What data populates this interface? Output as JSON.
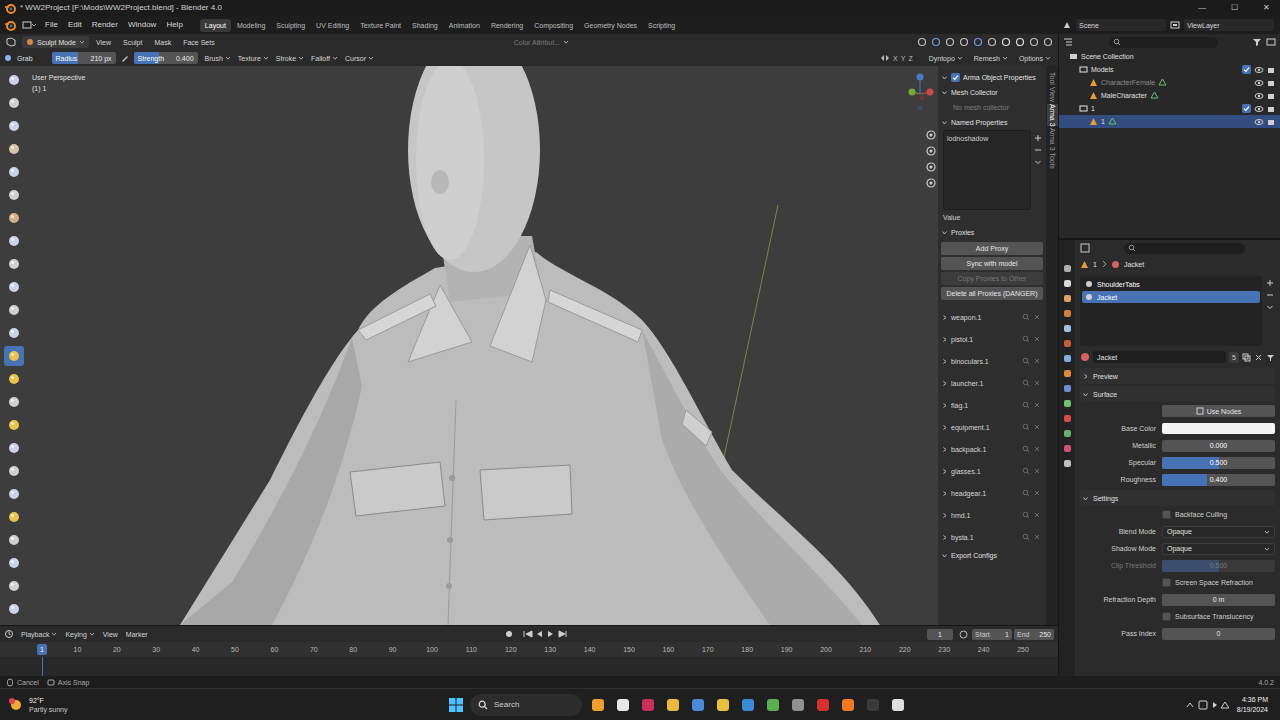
{
  "window": {
    "title": "* WW2Project [F:\\Mods\\WW2Project.blend] - Blender 4.0",
    "controls": [
      "—",
      "☐",
      "✕"
    ]
  },
  "menu": [
    "File",
    "Edit",
    "Render",
    "Window",
    "Help"
  ],
  "workspaces": [
    {
      "label": "Layout",
      "selected": true
    },
    {
      "label": "Modeling",
      "selected": false
    },
    {
      "label": "Sculpting",
      "selected": false
    },
    {
      "label": "UV Editing",
      "selected": false
    },
    {
      "label": "Texture Paint",
      "selected": false
    },
    {
      "label": "Shading",
      "selected": false
    },
    {
      "label": "Animation",
      "selected": false
    },
    {
      "label": "Rendering",
      "selected": false
    },
    {
      "label": "Compositing",
      "selected": false
    },
    {
      "label": "Geometry Nodes",
      "selected": false
    },
    {
      "label": "Scripting",
      "selected": false
    }
  ],
  "scene": {
    "scene": "Scene",
    "view_layer": "ViewLayer"
  },
  "viewport_header": {
    "mode": "Sculpt Mode",
    "menus": [
      "View",
      "Sculpt",
      "Mask",
      "Face Sets"
    ],
    "color_attribute": "Color Attribut..."
  },
  "tool_settings": {
    "tool": "Grab",
    "radius_label": "Radius",
    "radius": "210 px",
    "radius_level": 0.42,
    "strength_label": "Strength",
    "strength": "0.400",
    "strength_level": 0.4,
    "menus": [
      "Brush",
      "Texture",
      "Stroke",
      "Falloff",
      "Cursor"
    ],
    "axes": [
      "X",
      "Y",
      "Z"
    ],
    "right_menus": [
      "Dyntopo",
      "Remesh",
      "Options"
    ]
  },
  "tools": [
    {
      "selected": false
    },
    {
      "selected": false
    },
    {
      "selected": false
    },
    {
      "selected": false
    },
    {
      "selected": false
    },
    {
      "selected": false
    },
    {
      "selected": false
    },
    {
      "selected": false
    },
    {
      "selected": false
    },
    {
      "selected": false
    },
    {
      "selected": false
    },
    {
      "selected": false
    },
    {
      "selected": true
    },
    {
      "selected": false
    },
    {
      "selected": false
    },
    {
      "selected": false
    },
    {
      "selected": false
    },
    {
      "selected": false
    },
    {
      "selected": false
    },
    {
      "selected": false
    },
    {
      "selected": false
    },
    {
      "selected": false
    },
    {
      "selected": false
    },
    {
      "selected": false
    }
  ],
  "viewport": {
    "view": "User Perspective",
    "object": "(1) 1"
  },
  "sidebar": {
    "tabs": [
      {
        "label": "Tool",
        "selected": false
      },
      {
        "label": "View",
        "selected": false
      },
      {
        "label": "Arma 3",
        "selected": true
      },
      {
        "label": "Arma 3 Tools",
        "selected": false
      }
    ],
    "arma_object": {
      "title": "Arma Object Properties",
      "expanded": true,
      "checked": true
    },
    "mesh_collector": {
      "title": "Mesh Collector",
      "expanded": true,
      "note": "No mesh collector"
    },
    "named_properties": {
      "title": "Named Properties",
      "expanded": true,
      "items": [
        "lodnoshadow"
      ],
      "value_label": "Value"
    },
    "proxies": {
      "title": "Proxies",
      "expanded": true,
      "buttons": [
        {
          "label": "Add Proxy",
          "disabled": false
        },
        {
          "label": "Sync with model",
          "disabled": false
        },
        {
          "label": "Copy Proxies to Other",
          "disabled": true
        },
        {
          "label": "Delete all Proxies (DANGER)",
          "disabled": false
        }
      ],
      "items": [
        {
          "label": "weapon.1",
          "expanded": false
        },
        {
          "label": "pistol.1",
          "expanded": false
        },
        {
          "label": "binoculars.1",
          "expanded": false
        },
        {
          "label": "launcher.1",
          "expanded": false
        },
        {
          "label": "flag.1",
          "expanded": false
        },
        {
          "label": "equipment.1",
          "expanded": false
        },
        {
          "label": "backpack.1",
          "expanded": false
        },
        {
          "label": "glasses.1",
          "expanded": false
        },
        {
          "label": "headgear.1",
          "expanded": false
        },
        {
          "label": "hmd.1",
          "expanded": false
        },
        {
          "label": "bysta.1",
          "expanded": false
        }
      ]
    },
    "export": {
      "title": "Export Configs",
      "expanded": true
    }
  },
  "outliner": {
    "items": [
      {
        "label": "Scene Collection",
        "kind": "scene",
        "depth": 0,
        "selected": false,
        "disabled": false
      },
      {
        "label": "Models",
        "kind": "collection",
        "depth": 1,
        "selected": false,
        "disabled": false,
        "checked": true
      },
      {
        "label": "CharacterFemale",
        "kind": "object",
        "depth": 2,
        "selected": false,
        "disabled": true
      },
      {
        "label": "MaleCharacter",
        "kind": "object",
        "depth": 2,
        "selected": false,
        "disabled": false
      },
      {
        "label": "1",
        "kind": "collection",
        "depth": 1,
        "selected": false,
        "disabled": false,
        "checked": true
      },
      {
        "label": "1",
        "kind": "object",
        "depth": 2,
        "selected": true,
        "disabled": false
      }
    ]
  },
  "properties": {
    "path": [
      "1",
      "Jacket"
    ],
    "slots": [
      {
        "label": "ShoulderTabs",
        "selected": false
      },
      {
        "label": "Jacket",
        "selected": true
      }
    ],
    "material": {
      "name": "Jacket",
      "users": "5"
    },
    "preview": {
      "title": "Preview",
      "expanded": false
    },
    "surface": {
      "title": "Surface",
      "expanded": true,
      "use_nodes": "Use Nodes",
      "rows": [
        {
          "kind": "color",
          "label": "Base Color",
          "color": "#f4f4f4",
          "disabled": false
        },
        {
          "kind": "slider",
          "label": "Metallic",
          "value": "0.000",
          "level": 0,
          "disabled": false
        },
        {
          "kind": "slider",
          "label": "Specular",
          "value": "0.500",
          "level": 0.5,
          "disabled": false
        },
        {
          "kind": "slider",
          "label": "Roughness",
          "value": "0.400",
          "level": 0.4,
          "disabled": false
        }
      ]
    },
    "settings": {
      "title": "Settings",
      "expanded": true,
      "rows": [
        {
          "kind": "checkbox",
          "label": "Backface Culling",
          "checked": false,
          "disabled": false
        },
        {
          "kind": "dropdown",
          "label": "Blend Mode",
          "value": "Opaque",
          "disabled": false
        },
        {
          "kind": "dropdown",
          "label": "Shadow Mode",
          "value": "Opaque",
          "disabled": false
        },
        {
          "kind": "slider",
          "label": "Clip Threshold",
          "value": "0.500",
          "level": 0.5,
          "disabled": true
        },
        {
          "kind": "checkbox",
          "label": "Screen Space Refraction",
          "checked": false,
          "disabled": false
        },
        {
          "kind": "field",
          "label": "Refraction Depth",
          "value": "0 m",
          "disabled": false
        },
        {
          "kind": "checkbox",
          "label": "Subsurface Translucency",
          "checked": false,
          "disabled": false
        },
        {
          "kind": "field",
          "label": "Pass Index",
          "value": "0",
          "disabled": false
        }
      ]
    }
  },
  "timeline": {
    "menus": [
      "Playback",
      "Keying",
      "View",
      "Marker"
    ],
    "frame": "1",
    "start_label": "Start",
    "start": "1",
    "end_label": "End",
    "end": "250",
    "cursor": "1",
    "ticks": [
      "10",
      "20",
      "30",
      "40",
      "50",
      "60",
      "70",
      "80",
      "90",
      "100",
      "110",
      "120",
      "130",
      "140",
      "150",
      "160",
      "170",
      "180",
      "190",
      "200",
      "210",
      "220",
      "230",
      "240",
      "250"
    ]
  },
  "status_bar": {
    "items": [
      "Cancel",
      "Axis Snap"
    ],
    "version": "4.0.2"
  },
  "taskbar": {
    "temperature": "92°F",
    "weather": "Partly sunny",
    "search": "Search",
    "time": "4:36 PM",
    "date": "8/19/2024"
  }
}
